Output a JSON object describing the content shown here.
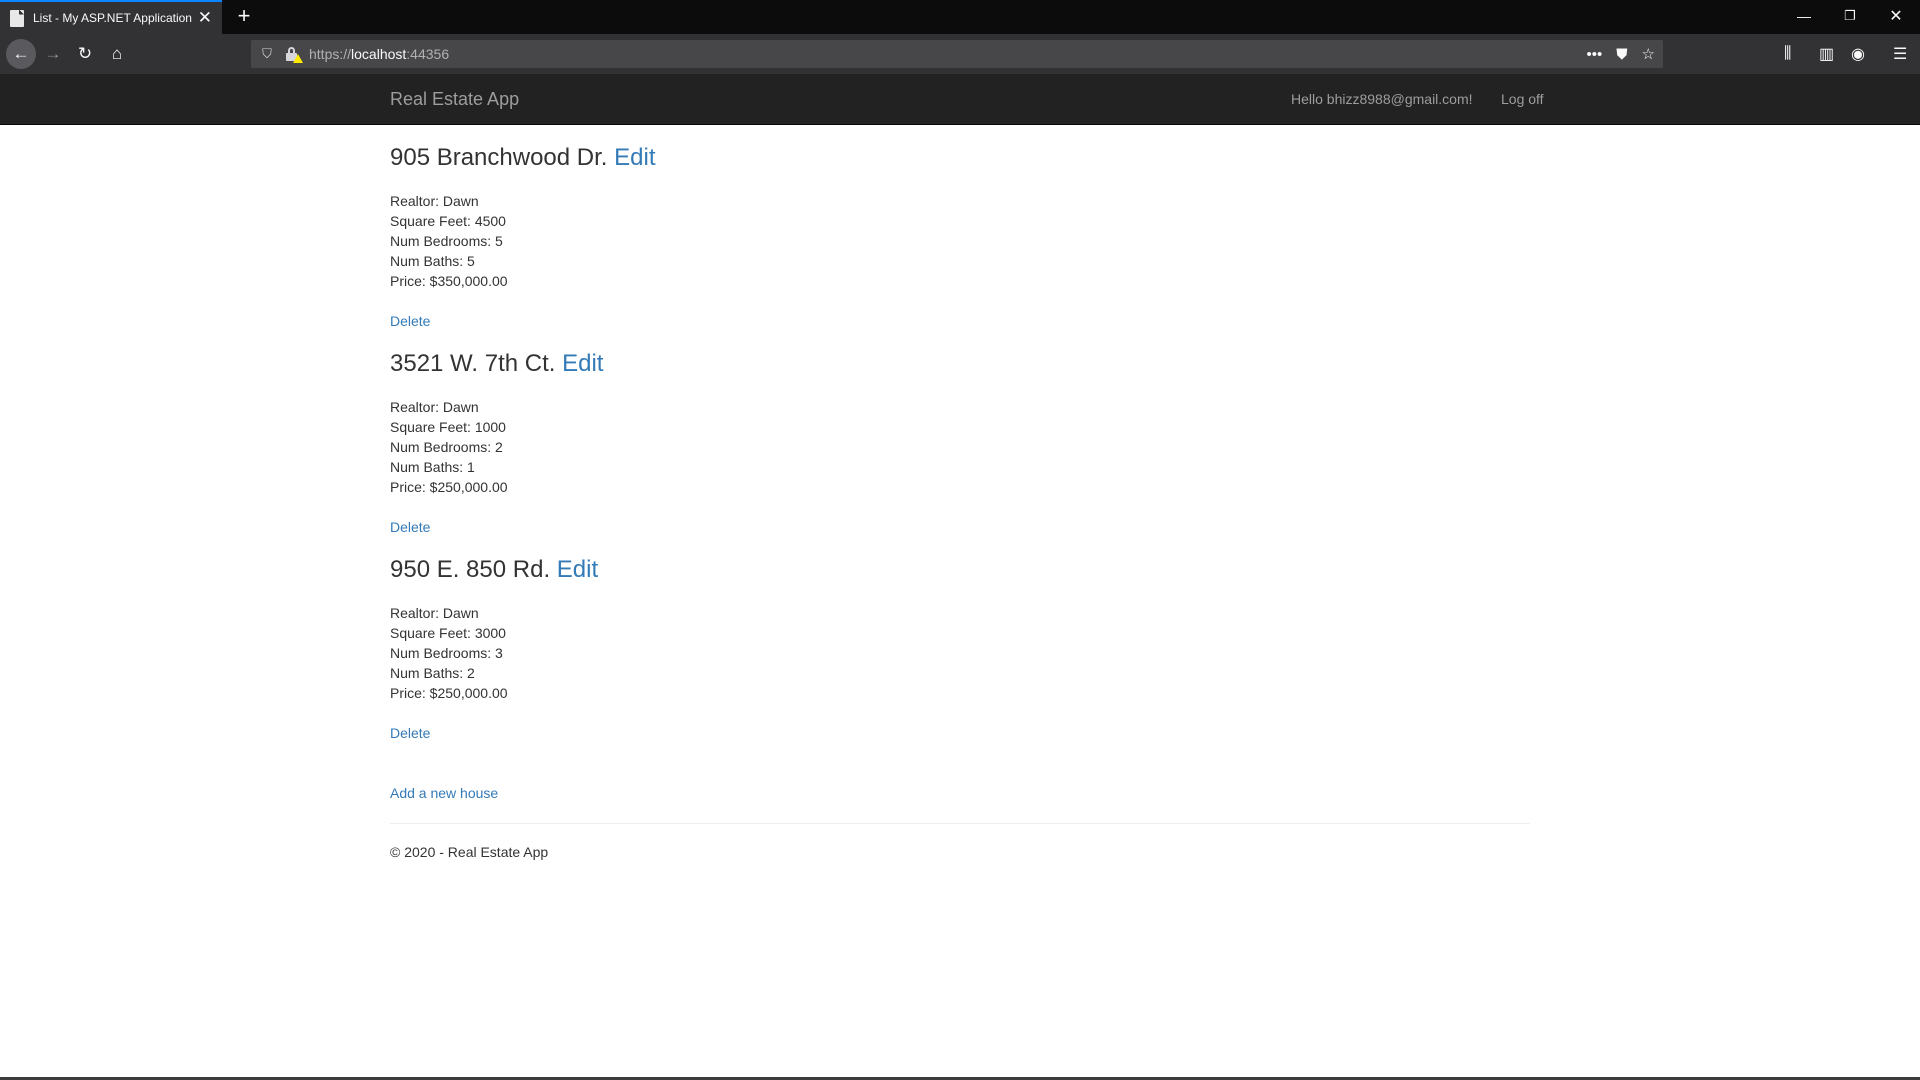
{
  "browser": {
    "tab_title": "List - My ASP.NET Application",
    "url_scheme": "https://",
    "url_host": "localhost",
    "url_port": ":44356"
  },
  "navbar": {
    "brand": "Real Estate App",
    "user_greeting": "Hello bhizz8988@gmail.com!",
    "logoff": "Log off"
  },
  "houses": [
    {
      "address": "905 Branchwood Dr.",
      "edit_label": "Edit",
      "realtor": "Realtor: Dawn",
      "square_feet": "Square Feet: 4500",
      "bedrooms": "Num Bedrooms: 5",
      "baths": "Num Baths: 5",
      "price": "Price: $350,000.00",
      "delete_label": "Delete"
    },
    {
      "address": "3521 W. 7th Ct.",
      "edit_label": "Edit",
      "realtor": "Realtor: Dawn",
      "square_feet": "Square Feet: 1000",
      "bedrooms": "Num Bedrooms: 2",
      "baths": "Num Baths: 1",
      "price": "Price: $250,000.00",
      "delete_label": "Delete"
    },
    {
      "address": "950 E. 850 Rd.",
      "edit_label": "Edit",
      "realtor": "Realtor: Dawn",
      "square_feet": "Square Feet: 3000",
      "bedrooms": "Num Bedrooms: 3",
      "baths": "Num Baths: 2",
      "price": "Price: $250,000.00",
      "delete_label": "Delete"
    }
  ],
  "add_house_label": "Add a new house",
  "footer": "© 2020 - Real Estate App",
  "colors": {
    "link": "#337ab7",
    "navbar_bg": "#222222",
    "navbar_text": "#9d9d9d",
    "tab_accent": "#0a84ff"
  }
}
